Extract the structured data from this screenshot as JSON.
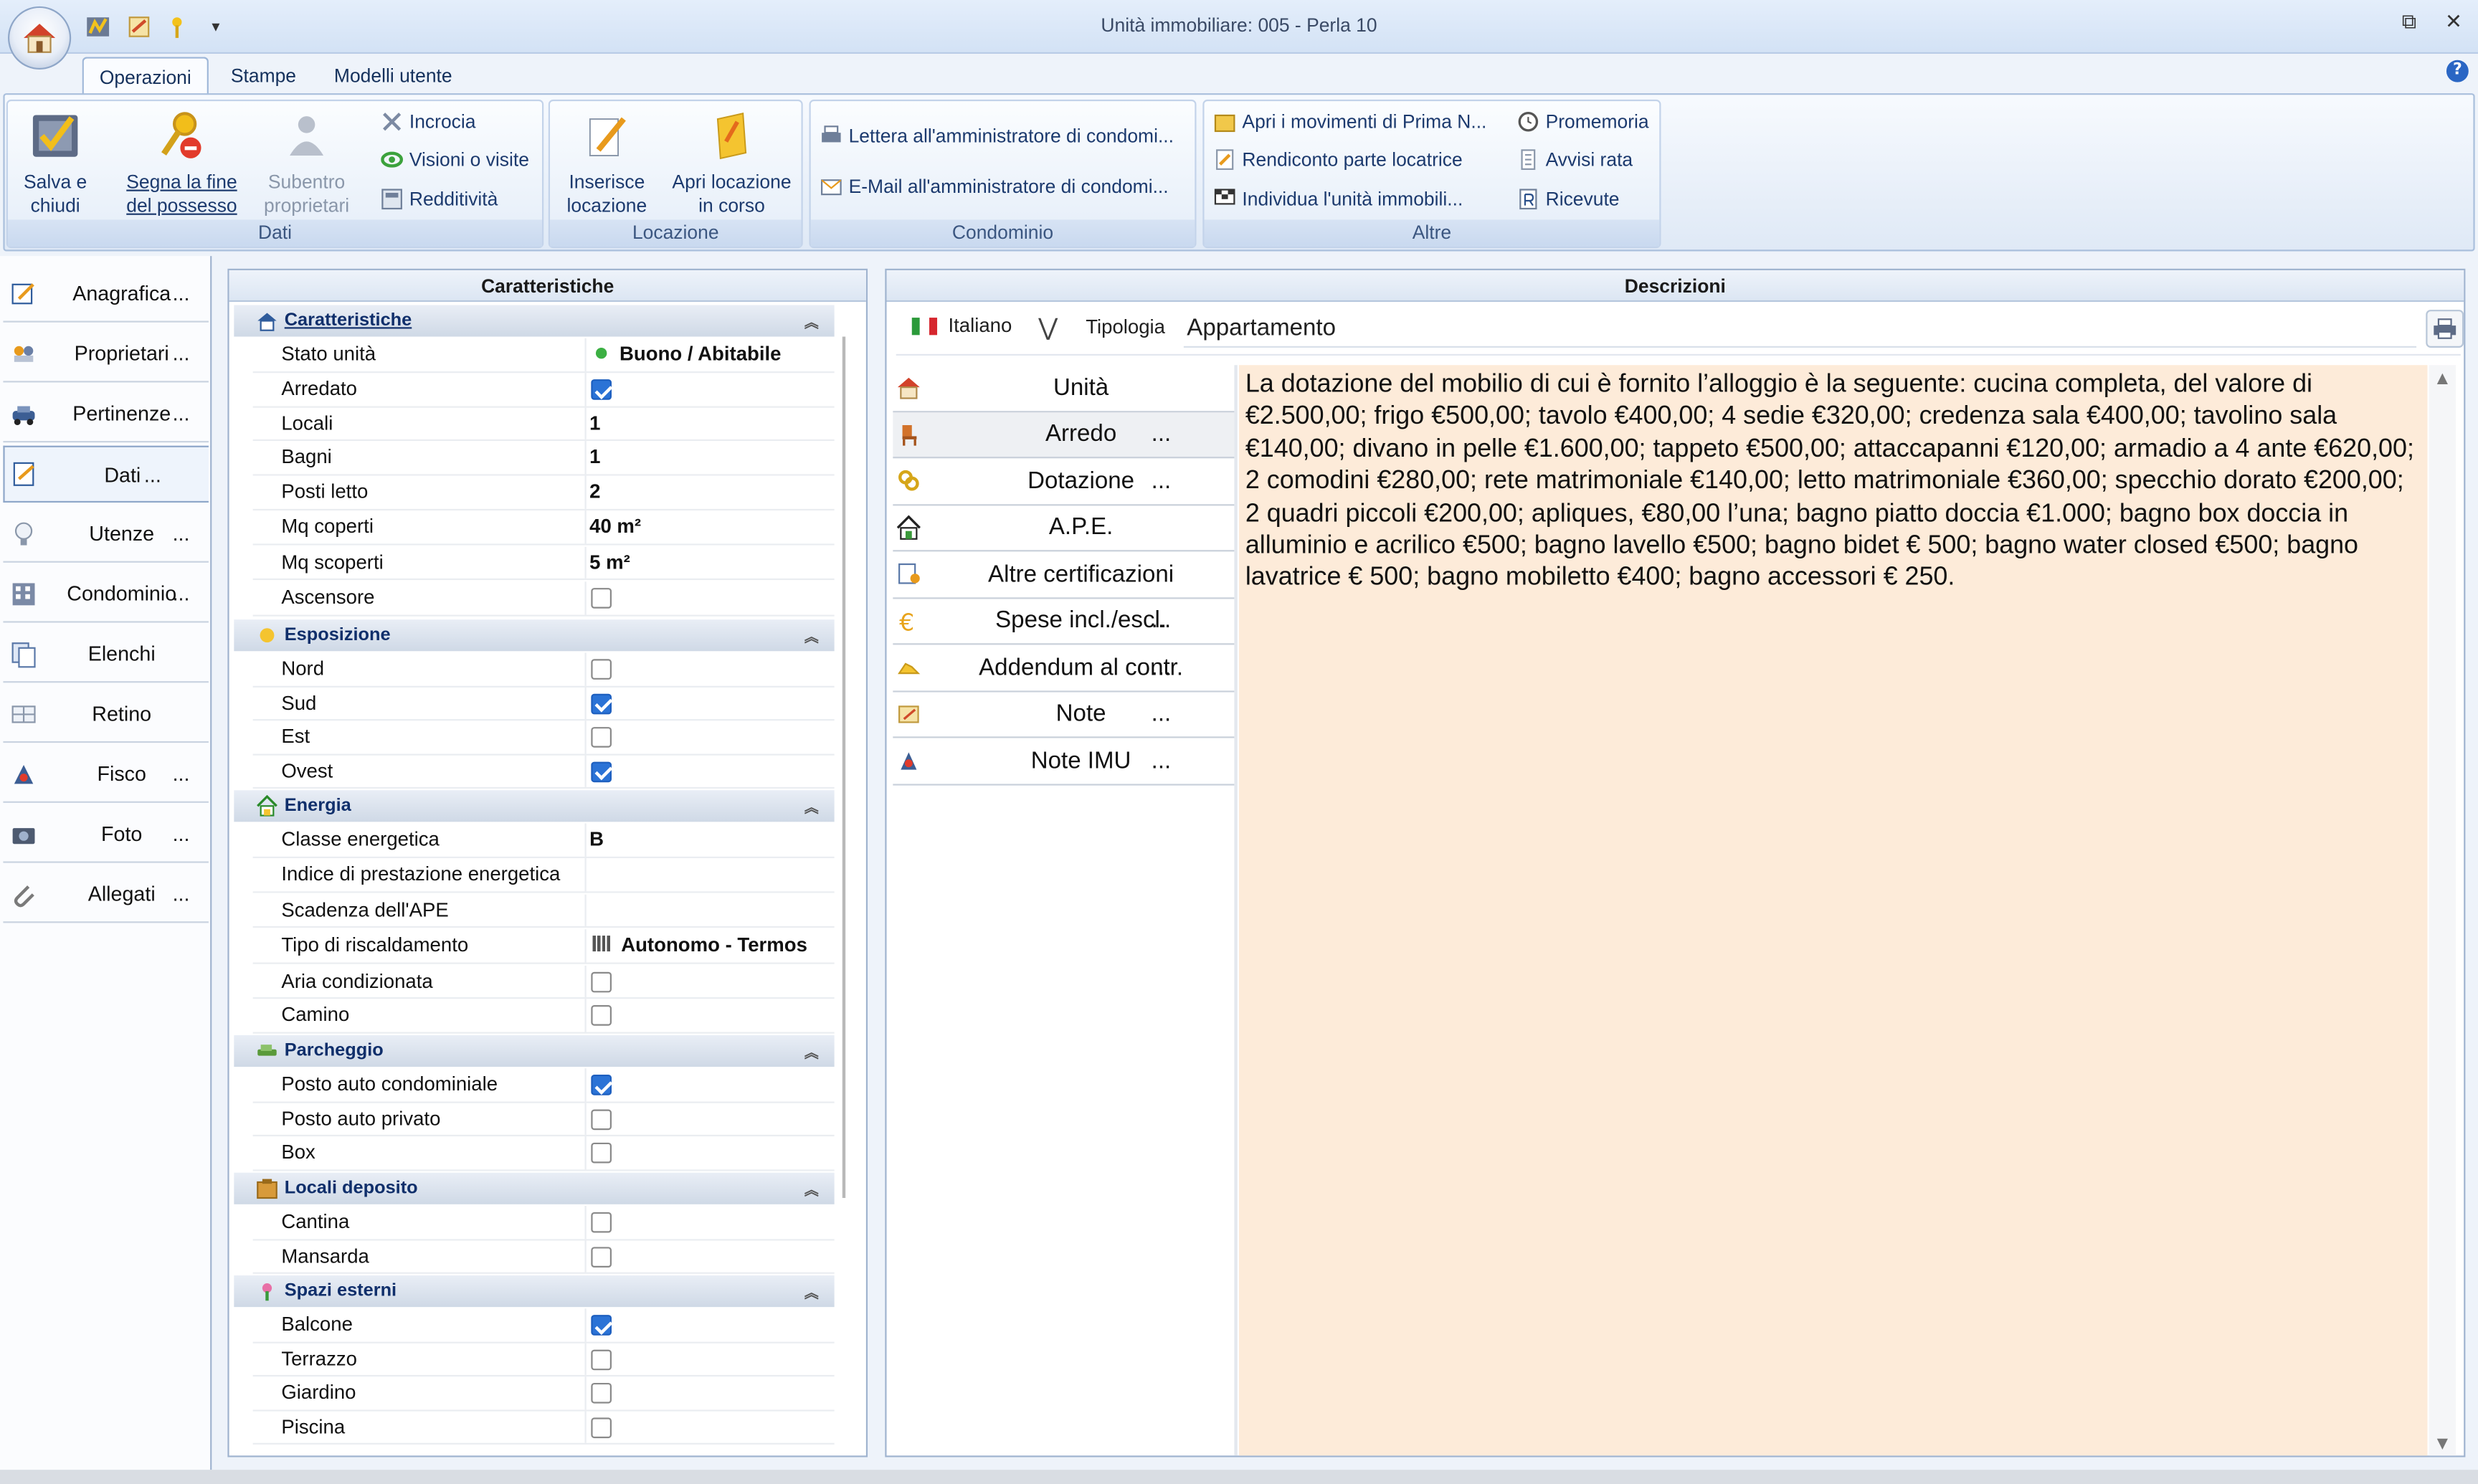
{
  "window": {
    "title": "Unità immobiliare: 005 - Perla 10",
    "minimize_glyph": "⧉",
    "close_glyph": "✕"
  },
  "quick_access": {
    "icons": [
      "save-icon",
      "notes-icon",
      "keys-icon"
    ],
    "more_glyph": "▾"
  },
  "tabs": [
    "Operazioni",
    "Stampe",
    "Modelli utente"
  ],
  "help_glyph": "?",
  "ribbon": {
    "dati": {
      "title": "Dati",
      "salva": "Salva e\nchiudi",
      "segna": "Segna la fine\ndel possesso",
      "subentro": "Subentro\nproprietari",
      "incrocia": "Incrocia",
      "visioni": "Visioni o visite",
      "redditivita": "Redditività"
    },
    "locazione": {
      "title": "Locazione",
      "inserisce": "Inserisce\nlocazione",
      "apri": "Apri locazione\nin corso"
    },
    "condominio": {
      "title": "Condominio",
      "lettera": "Lettera all'amministratore di condomi...",
      "email": "E-Mail all'amministratore di condomi..."
    },
    "altre": {
      "title": "Altre",
      "movimenti": "Apri i movimenti di Prima N...",
      "rendiconto": "Rendiconto parte locatrice",
      "individua": "Individua l'unità immobili...",
      "promemoria": "Promemoria",
      "avvisi": "Avvisi rata",
      "ricevute": "Ricevute"
    }
  },
  "sidebar": [
    {
      "label": "Anagrafica",
      "dots": "..."
    },
    {
      "label": "Proprietari",
      "dots": "..."
    },
    {
      "label": "Pertinenze",
      "dots": "..."
    },
    {
      "label": "Dati",
      "dots": "..."
    },
    {
      "label": "Utenze",
      "dots": "..."
    },
    {
      "label": "Condominio",
      "dots": "..."
    },
    {
      "label": "Elenchi",
      "dots": ""
    },
    {
      "label": "Retino",
      "dots": ""
    },
    {
      "label": "Fisco",
      "dots": "..."
    },
    {
      "label": "Foto",
      "dots": "..."
    },
    {
      "label": "Allegati",
      "dots": "..."
    }
  ],
  "caratteristiche": {
    "header": "Caratteristiche",
    "categories": {
      "caratteristiche": "Caratteristiche",
      "esposizione": "Esposizione",
      "energia": "Energia",
      "parcheggio": "Parcheggio",
      "locali_deposito": "Locali deposito",
      "spazi_esterni": "Spazi esterni"
    },
    "rows": {
      "stato_unita": {
        "label": "Stato unità",
        "value": "Buono / Abitabile",
        "status_color": "#3cb043"
      },
      "arredato": {
        "label": "Arredato",
        "checked": true
      },
      "locali": {
        "label": "Locali",
        "value": "1"
      },
      "bagni": {
        "label": "Bagni",
        "value": "1"
      },
      "posti_letto": {
        "label": "Posti letto",
        "value": "2"
      },
      "mq_coperti": {
        "label": "Mq coperti",
        "value": "40 m²"
      },
      "mq_scoperti": {
        "label": "Mq scoperti",
        "value": "5 m²"
      },
      "ascensore": {
        "label": "Ascensore",
        "checked": false
      },
      "nord": {
        "label": "Nord",
        "checked": false
      },
      "sud": {
        "label": "Sud",
        "checked": true
      },
      "est": {
        "label": "Est",
        "checked": false
      },
      "ovest": {
        "label": "Ovest",
        "checked": true
      },
      "classe": {
        "label": "Classe energetica",
        "value": "B"
      },
      "indice": {
        "label": "Indice di prestazione energetica",
        "value": ""
      },
      "scadenza": {
        "label": "Scadenza dell'APE",
        "value": ""
      },
      "riscaldamento": {
        "label": "Tipo di riscaldamento",
        "value": "Autonomo - Termos"
      },
      "aria": {
        "label": "Aria condizionata",
        "checked": false
      },
      "camino": {
        "label": "Camino",
        "checked": false
      },
      "posto_cond": {
        "label": "Posto auto condominiale",
        "checked": true
      },
      "posto_priv": {
        "label": "Posto auto privato",
        "checked": false
      },
      "box": {
        "label": "Box",
        "checked": false
      },
      "cantina": {
        "label": "Cantina",
        "checked": false
      },
      "mansarda": {
        "label": "Mansarda",
        "checked": false
      },
      "balcone": {
        "label": "Balcone",
        "checked": true
      },
      "terrazzo": {
        "label": "Terrazzo",
        "checked": false
      },
      "giardino": {
        "label": "Giardino",
        "checked": false
      },
      "piscina": {
        "label": "Piscina",
        "checked": false
      }
    }
  },
  "descrizioni": {
    "header": "Descrizioni",
    "language": "Italiano",
    "language_chevron": "⋁",
    "tipologia_label": "Tipologia",
    "tipologia_value": "Appartamento",
    "items": [
      {
        "label": "Unità",
        "dots": ""
      },
      {
        "label": "Arredo",
        "dots": "..."
      },
      {
        "label": "Dotazione",
        "dots": "..."
      },
      {
        "label": "A.P.E.",
        "dots": ""
      },
      {
        "label": "Altre certificazioni",
        "dots": ""
      },
      {
        "label": "Spese incl./escl.",
        "dots": "..."
      },
      {
        "label": "Addendum al contr.",
        "dots": "..."
      },
      {
        "label": "Note",
        "dots": "..."
      },
      {
        "label": "Note IMU",
        "dots": "..."
      }
    ],
    "text": "La dotazione del mobilio di cui è fornito l’alloggio è la seguente: cucina completa, del valore di €2.500,00; frigo €500,00; tavolo €400,00; 4 sedie €320,00; credenza sala €400,00; tavolino sala €140,00; divano in pelle €1.600,00; tappeto €500,00; attaccapanni €120,00; armadio a 4 ante €620,00; 2 comodini €280,00; rete matrimoniale €140,00; letto matrimoniale €360,00; specchio dorato €200,00; 2 quadri piccoli €200,00; apliques, €80,00 l’una; bagno piatto doccia €1.000; bagno box doccia in alluminio e acrilico €500; bagno lavello €500; bagno bidet € 500; bagno water closed €500; bagno lavatrice € 500; bagno mobiletto €400; bagno accessori € 250."
  }
}
